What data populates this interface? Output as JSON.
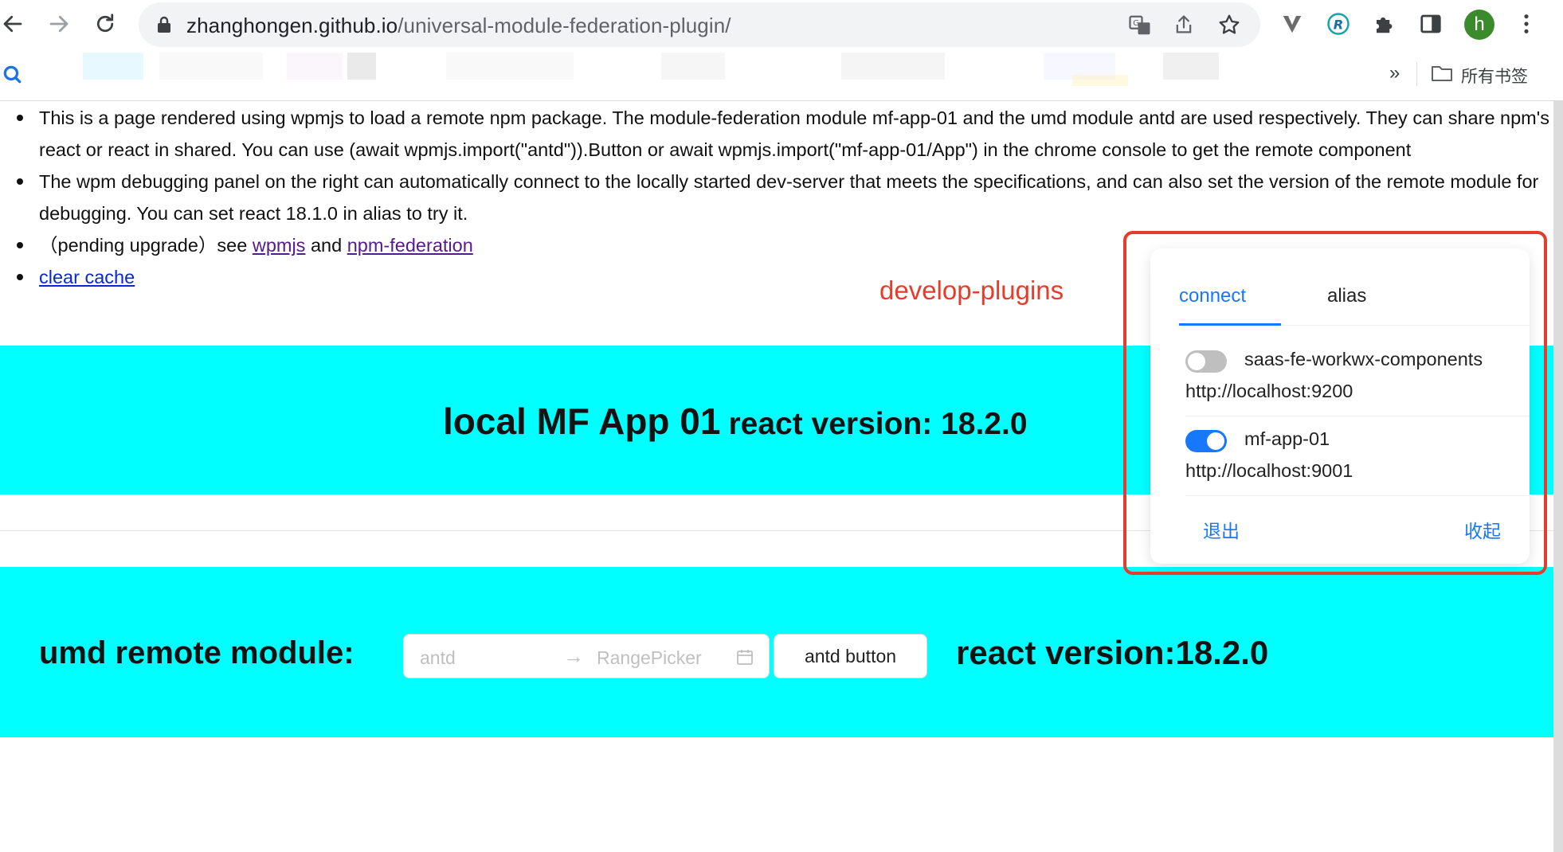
{
  "browser": {
    "url_host": "zhanghongen.github.io",
    "url_path": "/universal-module-federation-plugin/",
    "avatar_letter": "h",
    "bookmarks_overflow": "»",
    "all_bookmarks": "所有书签"
  },
  "notes": {
    "item1": "This is a page rendered using wpmjs to load a remote npm package. The module-federation module mf-app-01 and the umd module antd are used respectively. They can share npm's react or react in shared. You can use (await wpmjs.import(\"antd\")).Button or await wpmjs.import(\"mf-app-01/App\") in the chrome console to get the remote component",
    "item2": "The wpm debugging panel on the right can automatically connect to the locally started dev-server that meets the specifications, and can also set the version of the remote module for debugging. You can set react 18.1.0 in alias to try it.",
    "item3_prefix": "（pending upgrade）see ",
    "item3_link1": "wpmjs",
    "item3_mid": " and ",
    "item3_link2": "npm-federation",
    "item4_link": "clear cache"
  },
  "mf_section": {
    "title": "local MF App 01",
    "react_version": "react version: 18.2.0"
  },
  "umd_section": {
    "label": "umd remote module:",
    "start_placeholder": "antd",
    "end_placeholder": "RangePicker",
    "button_label": "antd button",
    "react_version": "react version:18.2.0"
  },
  "annotation": "develop-plugins",
  "debug_panel": {
    "tabs": [
      "connect",
      "alias"
    ],
    "active_tab": "connect",
    "connections": [
      {
        "name": "saas-fe-workwx-components",
        "url": "http://localhost:9200",
        "enabled": false
      },
      {
        "name": "mf-app-01",
        "url": "http://localhost:9001",
        "enabled": true
      }
    ],
    "exit_label": "退出",
    "collapse_label": "收起"
  },
  "colors": {
    "band": "#00ffff",
    "accent": "#1677ff",
    "annotation": "#e53c2b"
  }
}
